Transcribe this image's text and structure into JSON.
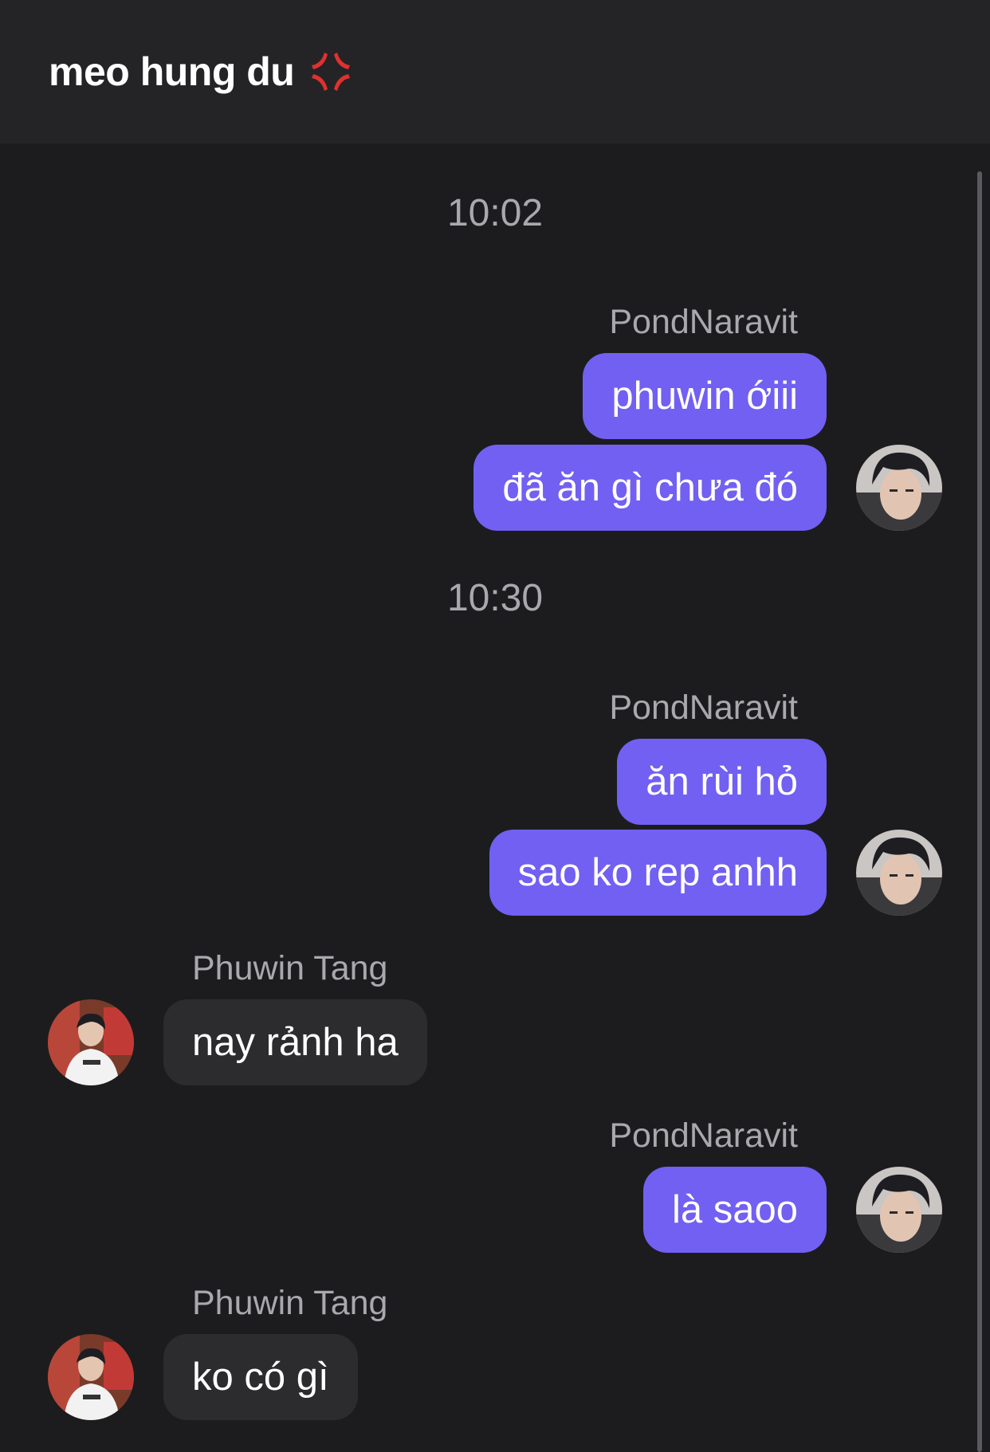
{
  "header": {
    "title": "meo hung du",
    "title_icon": "anger-symbol-icon"
  },
  "messages": {
    "t1": "10:02",
    "s1": "PondNaravit",
    "m1": "phuwin ớiii",
    "m2": "đã ăn gì chưa đó",
    "t2": "10:30",
    "s2": "PondNaravit",
    "m3": "ăn rùi hỏ",
    "m4": "sao ko rep anhh",
    "s3": "Phuwin Tang",
    "m5": "nay rảnh ha",
    "s4": "PondNaravit",
    "m6": "là saoo",
    "s5": "Phuwin Tang",
    "m7": "ko có gì"
  },
  "colors": {
    "outgoing_bubble": "#7160f2",
    "incoming_bubble": "#2c2c2e",
    "background": "#1c1c1e",
    "header": "#242426"
  }
}
